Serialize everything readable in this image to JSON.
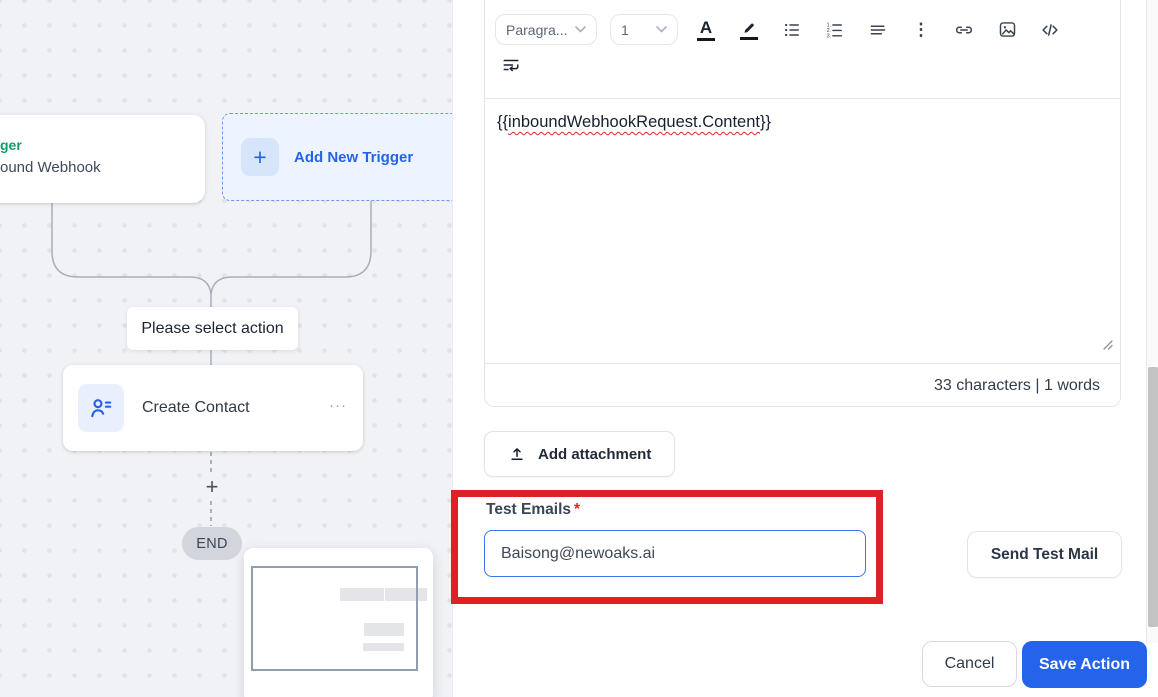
{
  "canvas": {
    "trigger_card": {
      "title_fragment": "ger",
      "subtitle_fragment": "ound Webhook"
    },
    "add_trigger": {
      "plus": "+",
      "label": "Add New Trigger"
    },
    "action_prompt": "Please select action",
    "create_contact": {
      "label": "Create Contact",
      "menu_icon": "···"
    },
    "insert_plus": "+",
    "end_label": "END"
  },
  "editor": {
    "toolbar": {
      "paragraph": "Paragra...",
      "font_size": "1",
      "color_glyph": "A",
      "more_glyph": "⋮",
      "icons": [
        "text-color",
        "highlight",
        "bullet-list",
        "ordered-list",
        "align",
        "more-options",
        "link",
        "image",
        "code",
        "text-wrap"
      ]
    },
    "body": {
      "prefix": "{{",
      "variable": "inboundWebhookRequest.Content",
      "suffix": "}}"
    },
    "stats": "33 characters | 1 words"
  },
  "attachment_button": "Add attachment",
  "test_emails": {
    "label": "Test Emails",
    "required_mark": "*",
    "value": "Baisong@newoaks.ai"
  },
  "actions": {
    "send_test": "Send Test Mail",
    "cancel": "Cancel",
    "save": "Save Action"
  },
  "colors": {
    "accent_blue": "#2563eb",
    "annotation_red": "#df2026",
    "trigger_green": "#0e9f6e"
  }
}
